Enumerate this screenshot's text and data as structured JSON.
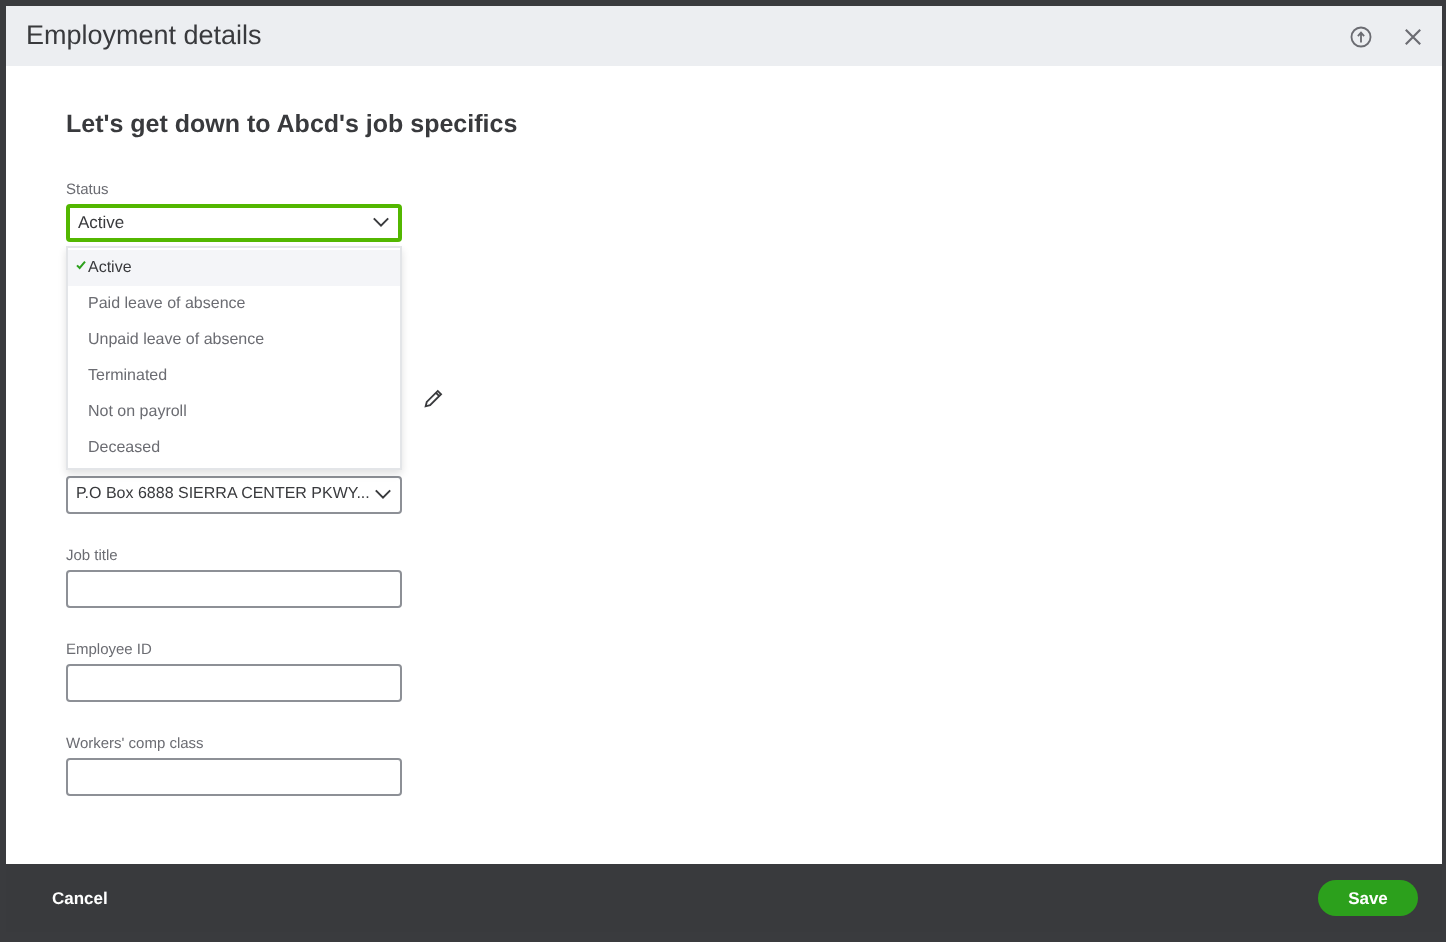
{
  "window": {
    "title": "Employment details"
  },
  "heading": "Let's get down to Abcd's job specifics",
  "status": {
    "label": "Status",
    "value": "Active",
    "expanded": true,
    "options": [
      {
        "label": "Active",
        "selected": true
      },
      {
        "label": "Paid leave of absence",
        "selected": false
      },
      {
        "label": "Unpaid leave of absence",
        "selected": false
      },
      {
        "label": "Terminated",
        "selected": false
      },
      {
        "label": "Not on payroll",
        "selected": false
      },
      {
        "label": "Deceased",
        "selected": false
      }
    ]
  },
  "work_location": {
    "value": "P.O Box 6888 SIERRA CENTER PKWY..."
  },
  "fields": [
    {
      "label": "Job title"
    },
    {
      "label": "Employee ID"
    },
    {
      "label": "Workers' comp class"
    }
  ],
  "footer": {
    "cancel": "Cancel",
    "save": "Save"
  }
}
